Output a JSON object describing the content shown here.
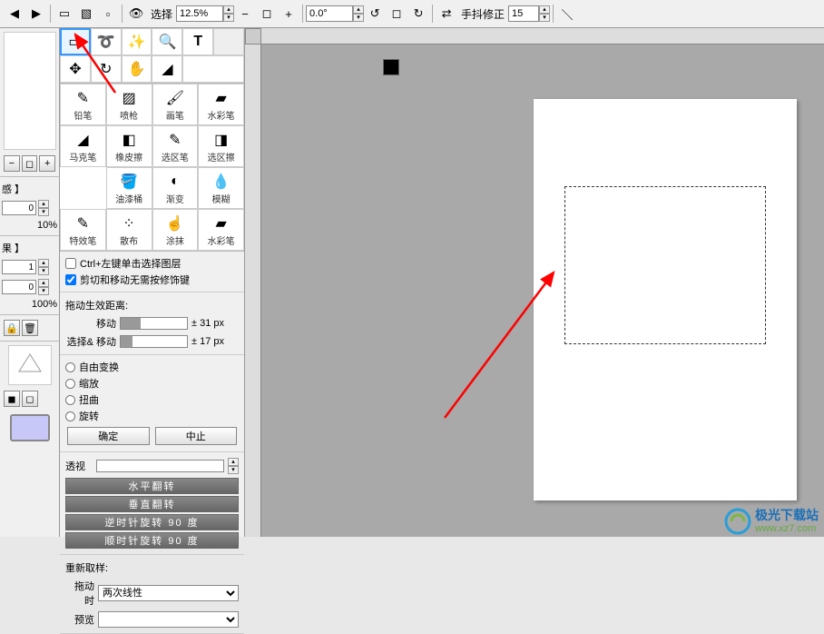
{
  "toolbar": {
    "select_label": "选择",
    "zoom_value": "12.5%",
    "angle_value": "0.0°",
    "shake_label": "手抖修正",
    "shake_value": "15"
  },
  "left_strip": {
    "label1": "感 】",
    "input1": "0",
    "pct1": "10%",
    "label2": "果 】",
    "input2": "1",
    "input3": "0",
    "pct2": "100%"
  },
  "tools": [
    {
      "name": "select-rect",
      "icon": "▭",
      "selected": true
    },
    {
      "name": "lasso",
      "icon": "➰"
    },
    {
      "name": "magic-wand",
      "icon": "✨"
    },
    {
      "name": "zoom",
      "icon": "🔍"
    },
    {
      "name": "text",
      "icon": "T"
    },
    {
      "name": "move",
      "icon": "✥"
    },
    {
      "name": "rotate-view",
      "icon": "↻"
    },
    {
      "name": "hand",
      "icon": "✋"
    },
    {
      "name": "color-picker",
      "icon": "◢"
    }
  ],
  "brushes": [
    {
      "label": "铅笔",
      "icon": "✎"
    },
    {
      "label": "喷枪",
      "icon": "▨"
    },
    {
      "label": "画笔",
      "icon": "🖌"
    },
    {
      "label": "水彩笔",
      "icon": "▰"
    },
    {
      "label": "马克笔",
      "icon": "◢"
    },
    {
      "label": "橡皮擦",
      "icon": "◧"
    },
    {
      "label": "选区笔",
      "icon": "✎"
    },
    {
      "label": "选区擦",
      "icon": "◨"
    },
    {
      "label": "油漆桶",
      "icon": "🪣",
      "offset": true
    },
    {
      "label": "渐变",
      "icon": "◐"
    },
    {
      "label": "模糊",
      "icon": "💧"
    },
    {
      "label": "特效笔",
      "icon": "✎"
    },
    {
      "label": "散布",
      "icon": "⁘"
    },
    {
      "label": "涂抹",
      "icon": "☝"
    },
    {
      "label": "水彩笔",
      "icon": "▰"
    }
  ],
  "options": {
    "ctrl_click_label": "Ctrl+左键单击选择图层",
    "cut_move_label": "剪切和移动无需按修饰键",
    "drag_section": "拖动生效距离:",
    "move_label": "移动",
    "move_value": "± 31 px",
    "selmove_label": "选择& 移动",
    "selmove_value": "± 17 px",
    "free_transform": "自由变换",
    "scale": "缩放",
    "distort": "扭曲",
    "rotate": "旋转",
    "ok_btn": "确定",
    "cancel_btn": "中止",
    "perspective_label": "透视",
    "flip_h": "水平翻转",
    "flip_v": "垂直翻转",
    "rot_ccw": "逆时针旋转 90 度",
    "rot_cw": "顺时针旋转 90 度",
    "resample_label": "重新取样:",
    "drag_when_label": "拖动时",
    "drag_when_value": "两次线性",
    "preview_label": "预览"
  },
  "watermark": {
    "line1": "极光下载站",
    "line2": "www.xz7.com"
  }
}
